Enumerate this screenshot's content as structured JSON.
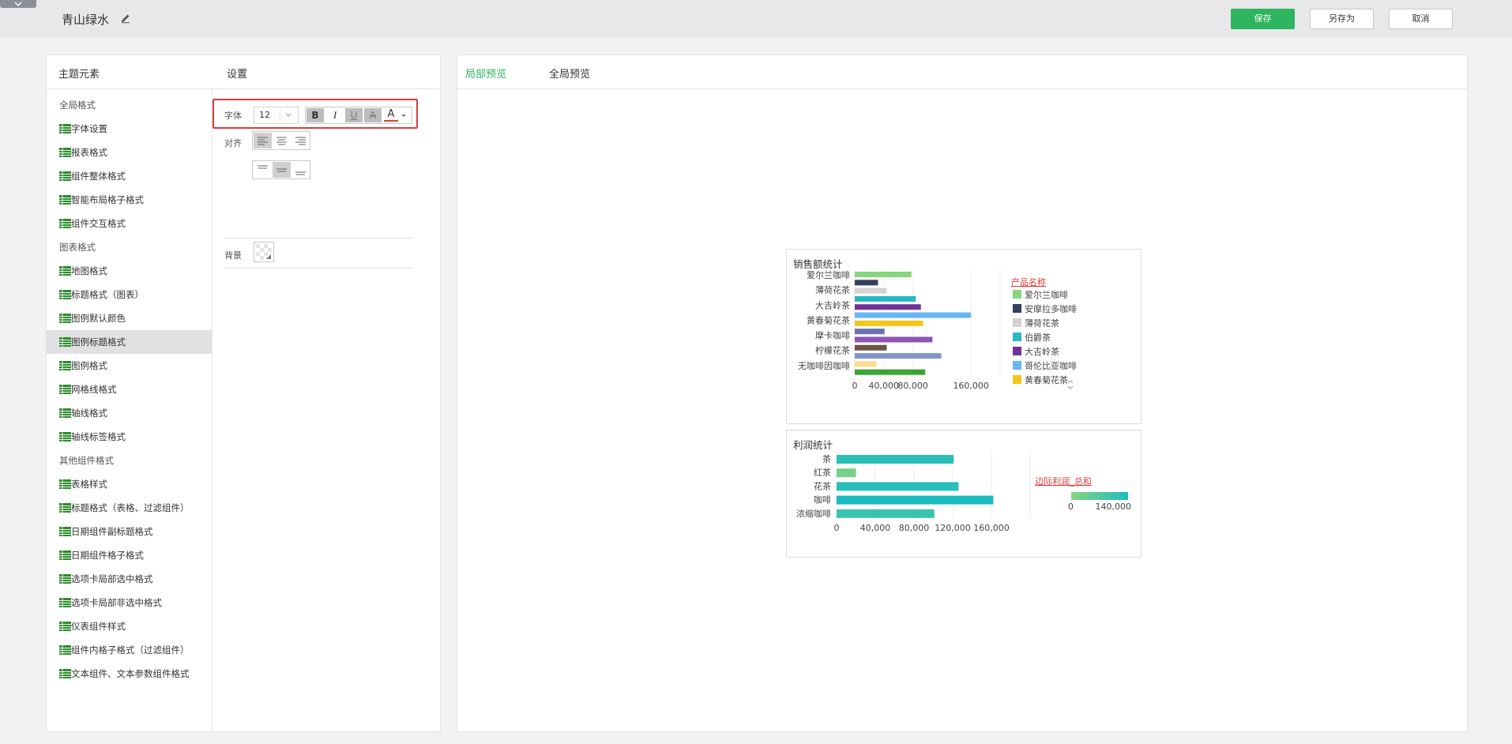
{
  "header": {
    "theme_name": "青山绿水",
    "save_label": "保存",
    "save_as_label": "另存为",
    "cancel_label": "取消"
  },
  "left": {
    "elements_title": "主题元素",
    "settings_title": "设置",
    "tree": [
      {
        "label": "全局格式",
        "group": true
      },
      {
        "label": "字体设置",
        "group": false
      },
      {
        "label": "报表格式",
        "group": false
      },
      {
        "label": "组件整体格式",
        "group": false
      },
      {
        "label": "智能布局格子格式",
        "group": false
      },
      {
        "label": "组件交互格式",
        "group": false
      },
      {
        "label": "图表格式",
        "group": true
      },
      {
        "label": "地图格式",
        "group": false
      },
      {
        "label": "标题格式（图表）",
        "group": false
      },
      {
        "label": "图例默认颜色",
        "group": false
      },
      {
        "label": "图例标题格式",
        "group": false,
        "selected": true
      },
      {
        "label": "图例格式",
        "group": false
      },
      {
        "label": "网格线格式",
        "group": false
      },
      {
        "label": "轴线格式",
        "group": false
      },
      {
        "label": "轴线标签格式",
        "group": false
      },
      {
        "label": "其他组件格式",
        "group": true
      },
      {
        "label": "表格样式",
        "group": false
      },
      {
        "label": "标题格式（表格、过滤组件）",
        "group": false
      },
      {
        "label": "日期组件副标题格式",
        "group": false
      },
      {
        "label": "日期组件格子格式",
        "group": false
      },
      {
        "label": "选项卡局部选中格式",
        "group": false
      },
      {
        "label": "选项卡局部非选中格式",
        "group": false
      },
      {
        "label": "仪表组件样式",
        "group": false
      },
      {
        "label": "组件内格子格式（过滤组件）",
        "group": false
      },
      {
        "label": "文本组件、文本参数组件格式",
        "group": false
      }
    ],
    "settings": {
      "font_label": "字体",
      "font_size": "12",
      "bold": "B",
      "italic": "I",
      "underline": "U",
      "strike": "A",
      "color": "A",
      "align_label": "对齐",
      "background_label": "背景",
      "font_color": "#e03b3b"
    }
  },
  "right": {
    "tab_local": "局部预览",
    "tab_global": "全局预览"
  },
  "colors": {
    "accent": "#2fb460",
    "highlight": "#e03b3b"
  },
  "chart_data": [
    {
      "type": "bar",
      "orientation": "horizontal",
      "title": "销售额统计",
      "categories": [
        "爱尔兰咖啡",
        "薄荷花茶",
        "大吉岭茶",
        "黄春菊花茶",
        "摩卡咖啡",
        "柠檬花茶",
        "无咖啡因咖啡"
      ],
      "xticks": [
        "0",
        "40,000",
        "80,000",
        "160,000"
      ],
      "xlim": [
        0,
        200000
      ],
      "legend_title": "产品名称",
      "legend": [
        {
          "name": "爱尔兰咖啡",
          "color": "#86d67e"
        },
        {
          "name": "安摩拉多咖啡",
          "color": "#34405e"
        },
        {
          "name": "薄荷花茶",
          "color": "#d3d3d3"
        },
        {
          "name": "伯爵茶",
          "color": "#27b8c3"
        },
        {
          "name": "大吉岭茶",
          "color": "#70329a"
        },
        {
          "name": "哥伦比亚咖啡",
          "color": "#66b6f3"
        },
        {
          "name": "黄春菊花茶",
          "color": "#f5c51a"
        }
      ],
      "bars": [
        {
          "value": 78000,
          "color": "#86d67e"
        },
        {
          "value": 32000,
          "color": "#34405e"
        },
        {
          "value": 44000,
          "color": "#d3d3d3"
        },
        {
          "value": 84000,
          "color": "#27b8c3"
        },
        {
          "value": 91000,
          "color": "#70329a"
        },
        {
          "value": 160000,
          "color": "#66b6f3"
        },
        {
          "value": 94000,
          "color": "#f5c51a"
        },
        {
          "value": 41000,
          "color": "#6a6fae"
        },
        {
          "value": 107000,
          "color": "#8e55b5"
        },
        {
          "value": 44000,
          "color": "#6e5342"
        },
        {
          "value": 119000,
          "color": "#8196c8"
        },
        {
          "value": 30000,
          "color": "#fbdc8e"
        },
        {
          "value": 97000,
          "color": "#3ba633"
        }
      ]
    },
    {
      "type": "bar",
      "orientation": "horizontal",
      "title": "利润统计",
      "categories": [
        "茶",
        "红茶",
        "花茶",
        "咖啡",
        "浓缩咖啡"
      ],
      "values": [
        121000,
        20000,
        126000,
        162000,
        101000
      ],
      "xticks": [
        "0",
        "40,000",
        "80,000",
        "120,000",
        "160,000"
      ],
      "xlim": [
        0,
        160000
      ],
      "legend_title": "边际利润_总和",
      "legend_range": [
        "0",
        "140,000"
      ],
      "gradient": [
        "#86d67e",
        "#1bbcc0"
      ]
    }
  ]
}
